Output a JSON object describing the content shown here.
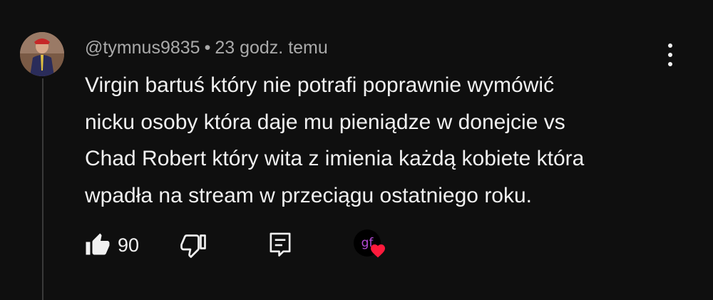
{
  "comment": {
    "author": "@tymnus9835",
    "separator": "•",
    "timestamp": "23 godz. temu",
    "text": "Virgin bartuś który nie potrafi poprawnie wymówić\nnicku osoby która daje mu pieniądze w donejcie vs\nChad Robert który wita z imienia każdą kobiete która\nwpadła na stream w przeciągu ostatniego roku.",
    "likes": "90",
    "creator_badge_text": "gf"
  },
  "icons": {
    "avatar": "user-avatar",
    "menu": "more-vert-icon",
    "like": "thumb-up-icon",
    "dislike": "thumb-down-icon",
    "reply": "reply-comment-icon",
    "heart": "heart-icon"
  },
  "colors": {
    "background": "#0f0f0f",
    "text": "#f1f1f1",
    "meta_text": "#aaaaaa",
    "heart": "#ff1a3c",
    "badge_text": "#b44bd6"
  }
}
